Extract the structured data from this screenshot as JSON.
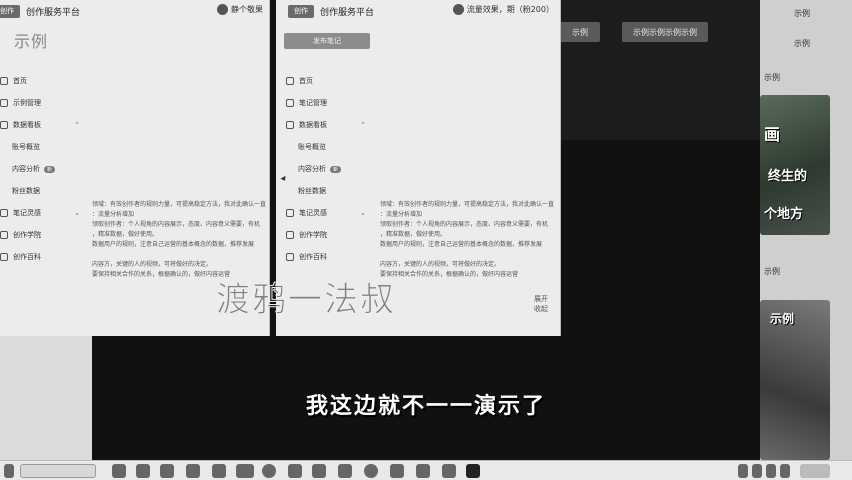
{
  "background": {
    "btn_a": "示例",
    "btn_b": "示例示例示例示例",
    "right_texts": [
      "示例",
      "示例",
      "示例",
      "示例"
    ],
    "thumb1_text_a": "画",
    "thumb1_text_b": "终生的",
    "thumb1_text_c": "个地方",
    "thumb2_text": "示例"
  },
  "left_window": {
    "logo": "创作",
    "brand": "创作服务平台",
    "user": "静个敬果",
    "big_title": "示例",
    "nav": [
      {
        "label": "首页"
      },
      {
        "label": "示例管理"
      },
      {
        "label": "数据看板"
      },
      {
        "label": "账号概览"
      },
      {
        "label": "内容分析",
        "badge": "新"
      },
      {
        "label": "粉丝数据"
      },
      {
        "label": "笔记灵感"
      },
      {
        "label": "创作学院"
      },
      {
        "label": "创作百科"
      }
    ],
    "paragraphs": [
      "领域：有效创作者的规则力量，可提高稳定方法，我对此确认一直",
      "：流量分析增加",
      "领取创作者：个人视角的内容展示，态度、内容意义需要，有机",
      "，精准数据，做好使用。",
      "数据用户的规则，注意自己运营的基本概念的数据，推荐发展",
      "",
      "内容方，关键的人的视频，可将做好的决定。",
      "要保持相关合作的关系，根据确认的，做好内容运营"
    ]
  },
  "right_window": {
    "logo": "创作",
    "brand": "创作服务平台",
    "user": "流量效果，期（粉200）",
    "publish_btn": "发布笔记",
    "nav": [
      {
        "label": "首页"
      },
      {
        "label": "笔记管理"
      },
      {
        "label": "数据看板"
      },
      {
        "label": "账号概览"
      },
      {
        "label": "内容分析",
        "badge": "新"
      },
      {
        "label": "粉丝数据"
      },
      {
        "label": "笔记灵感"
      },
      {
        "label": "创作学院"
      },
      {
        "label": "创作百科"
      }
    ],
    "paragraphs": [
      "领域：有效创作者的规则力量，可提高稳定方法，我对此确认一直",
      "：流量分析增加",
      "领取创作者：个人视角的内容展示，态度、内容意义需要，有机",
      "，精准数据，做好使用。",
      "数据用户的规则，注意自己运营的基本概念的数据，推荐发展",
      "",
      "内容方，关键的人的视频，可将做好的决定。",
      "要保持相关合作的关系，根据确认的，做好内容运营"
    ],
    "more_a": "展开",
    "more_b": "收起"
  },
  "watermark": "渡鸦一法叔",
  "subtitle": "我这边就不一一演示了"
}
